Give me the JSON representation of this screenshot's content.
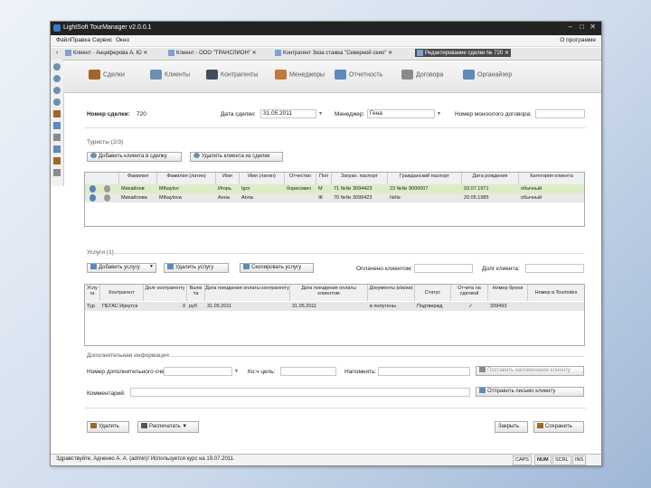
{
  "window": {
    "title": "LightSoft TourManager v2.0.0.1",
    "login_label": "О программе"
  },
  "menu": [
    "Файл",
    "Правка",
    "Сервис",
    "Окно"
  ],
  "tabs": [
    {
      "label": "Клиент - Анциферова А. Ю"
    },
    {
      "label": "Клиент - ООО \"ТРАНСЛИОН\""
    },
    {
      "label": "Контрагент Зеза стажка \"Северной сеио\""
    },
    {
      "label": "Редактирование сделки № 720",
      "active": true
    }
  ],
  "toolbar": [
    {
      "label": "Сделки",
      "icon": "briefcase-icon"
    },
    {
      "label": "Клиенты",
      "icon": "client-icon"
    },
    {
      "label": "Контрагенты",
      "icon": "partner-icon"
    },
    {
      "label": "Менеджеры",
      "icon": "manager-icon"
    },
    {
      "label": "Отчетность",
      "icon": "report-icon"
    },
    {
      "label": "Договора",
      "icon": "handshake-icon"
    },
    {
      "label": "Органайзер",
      "icon": "calendar-icon"
    }
  ],
  "deal": {
    "number_label": "Номер сделки:",
    "number": "720",
    "date_label": "Дата сделки:",
    "date": "31.05.2011",
    "manager_label": "Менеджер:",
    "manager": "Гена",
    "contract_label": "Номер моноолого договора:"
  },
  "tourists": {
    "section_label": "Туристы (2/3)",
    "add_button": "Добавить клиента в сделку",
    "remove_button": "Удалить клиента из сделки",
    "columns": [
      "Фамилия",
      "Фамилия (латин)",
      "Имя",
      "Имя (латин)",
      "Отчество",
      "Пол",
      "Загран. паспорт",
      "Гражданский паспорт",
      "Дата рождения",
      "Категория клиента"
    ],
    "rows": [
      [
        "Михайлов",
        "Mihaylov",
        "Игорь",
        "Igor",
        "борисович",
        "М",
        "71 №№ 3094423",
        "23 №№ 9000007",
        "03.07.1971",
        "обычный"
      ],
      [
        "Михайлова",
        "Mihaylova",
        "Анна",
        "Anna",
        "",
        "Ж",
        "70 №№ 3099423",
        "№№",
        "20.05.1985",
        "обычный"
      ]
    ]
  },
  "services": {
    "section_label": "Услуги (1)",
    "add_button": "Добавить услугу",
    "remove_button": "Удалить услугу",
    "copy_button": "Скопировать услугу",
    "paid_label": "Оплачено клиентом:",
    "debt_label": "Долг клиента:",
    "columns": [
      "Услу га",
      "Контрагент",
      "Долг контрагенту",
      "Валю та",
      "Дата поездения оплаты контрагенту",
      "Дата поездения оплаты клиентом",
      "Документы (к/в/ии)",
      "Статус",
      "Отчета на сделкой",
      "Номер брони",
      "Номер в Tourindex"
    ],
    "rows": [
      [
        "Тур",
        "ПЕГАС Иркутск",
        "0",
        "руб",
        "31.05.2011",
        "31.05.2011",
        "в полутены",
        "Подтвержд",
        "✓",
        "339493",
        ""
      ]
    ]
  },
  "extra": {
    "section_label": "Дополнительная информация",
    "source_label": "Номер дополнительного счета:",
    "purpose_label": "Ко:ч цель:",
    "reminder_label": "Напомнить:",
    "set_reminder_button": "Поставить напоминание клиенту",
    "comment_label": "Комментарий:",
    "send_button": "Отправить письмо клиенту"
  },
  "footer": {
    "delete_button": "Удалить",
    "print_button": "Распечатать",
    "close_button": "Закрыть",
    "save_button": "Сохранить"
  },
  "status": {
    "text": "Здравствуйте, Адченко А. А. (admin)! Используется курс на 19.07.2011.",
    "indicators": [
      "CAPS",
      "NUM",
      "SCRL",
      "INS"
    ]
  }
}
